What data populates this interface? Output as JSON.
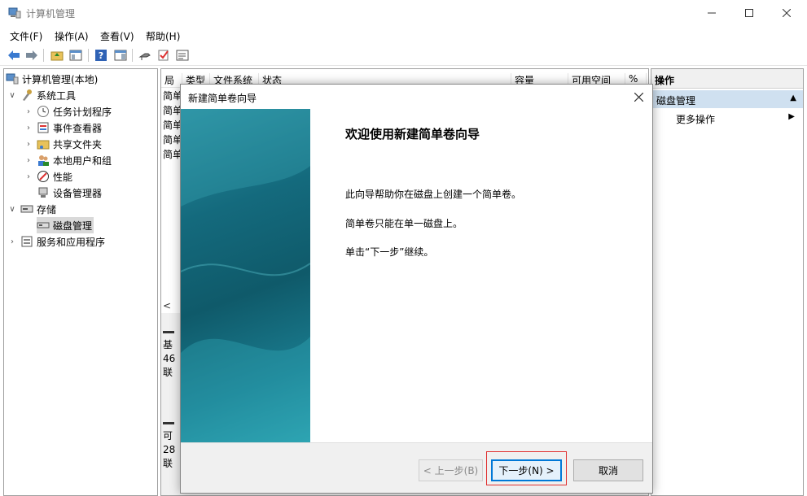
{
  "window": {
    "title": "计算机管理"
  },
  "menu": [
    "文件(F)",
    "操作(A)",
    "查看(V)",
    "帮助(H)"
  ],
  "tree": {
    "root": "计算机管理(本地)",
    "system_tools": "系统工具",
    "task_scheduler": "任务计划程序",
    "event_viewer": "事件查看器",
    "shared_folders": "共享文件夹",
    "local_users": "本地用户和组",
    "performance": "性能",
    "device_manager": "设备管理器",
    "storage": "存储",
    "disk_management": "磁盘管理",
    "services_apps": "服务和应用程序"
  },
  "list": {
    "columns": [
      "局",
      "类型",
      "文件系统",
      "状态",
      "容量",
      "可用空间",
      "%"
    ],
    "rows": [
      "简单",
      "简单",
      "简单",
      "简单",
      "简单"
    ],
    "scroll_left": "<",
    "disk_blocks": [
      {
        "line1": "基",
        "line2": "46",
        "line3": "联"
      },
      {
        "line1": "可",
        "line2": "28",
        "line3": "联"
      }
    ]
  },
  "actions": {
    "title": "操作",
    "section": "磁盘管理",
    "more": "更多操作"
  },
  "dialog": {
    "title": "新建简单卷向导",
    "heading": "欢迎使用新建简单卷向导",
    "text1": "此向导帮助你在磁盘上创建一个简单卷。",
    "text2": "简单卷只能在单一磁盘上。",
    "text3": "单击“下一步”继续。",
    "back": "< 上一步(B)",
    "next": "下一步(N) >",
    "cancel": "取消"
  }
}
